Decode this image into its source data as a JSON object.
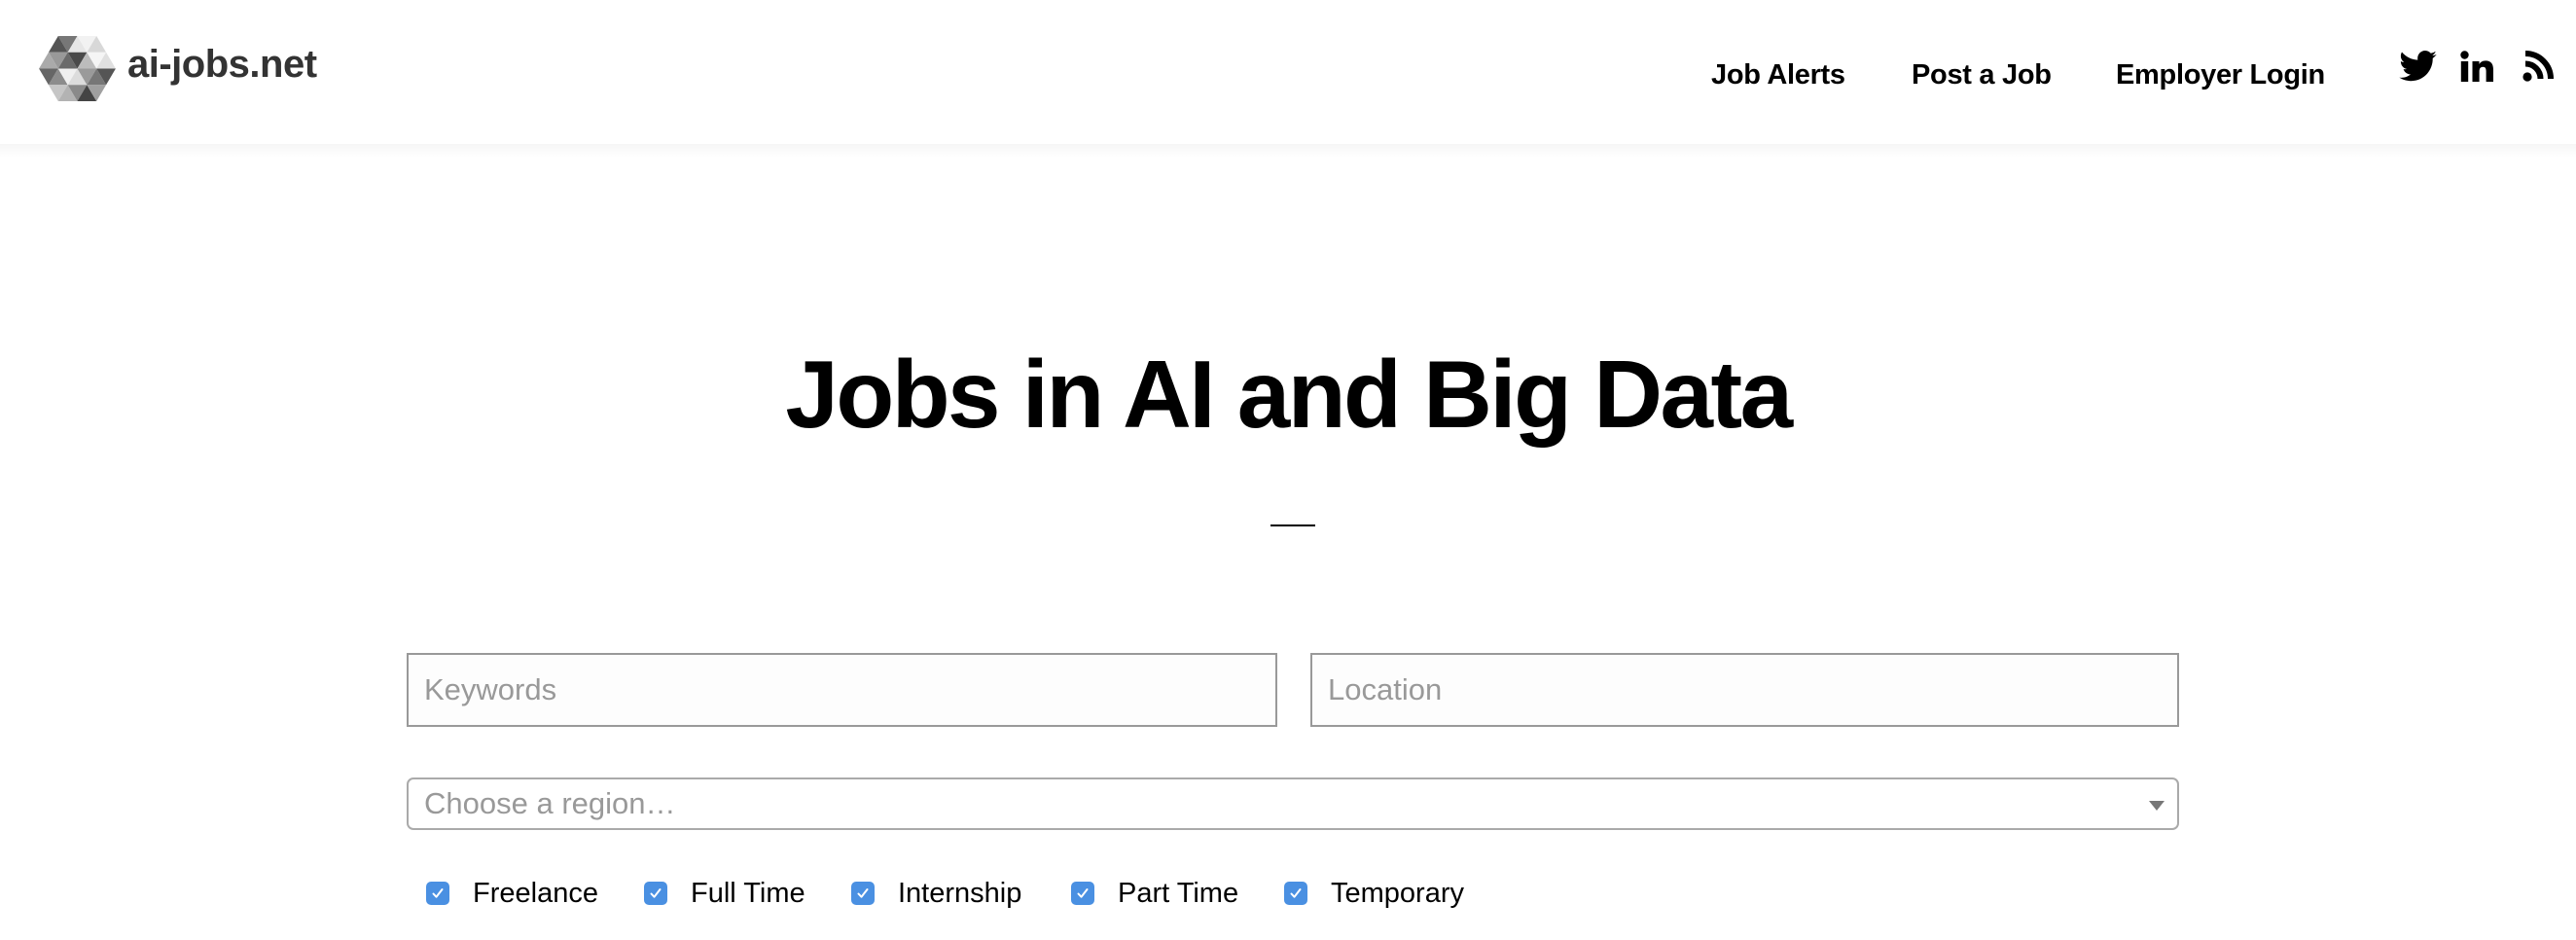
{
  "header": {
    "logo_text": "ai-jobs.net",
    "nav": [
      {
        "label": "Job Alerts"
      },
      {
        "label": "Post a Job"
      },
      {
        "label": "Employer Login"
      }
    ],
    "social": [
      {
        "icon": "twitter-icon",
        "label": "Twitter"
      },
      {
        "icon": "linkedin-icon",
        "label": "LinkedIn"
      },
      {
        "icon": "rss-icon",
        "label": "RSS feed"
      }
    ]
  },
  "main": {
    "title": "Jobs in AI and Big Data",
    "search": {
      "keywords_placeholder": "Keywords",
      "keywords_value": "",
      "location_placeholder": "Location",
      "location_value": "",
      "region_placeholder": "Choose a region…",
      "region_value": ""
    },
    "job_types": [
      {
        "label": "Freelance",
        "checked": true
      },
      {
        "label": "Full Time",
        "checked": true
      },
      {
        "label": "Internship",
        "checked": true
      },
      {
        "label": "Part Time",
        "checked": true
      },
      {
        "label": "Temporary",
        "checked": true
      }
    ]
  },
  "colors": {
    "checkbox_accent": "#4a90e2",
    "input_border": "#999999",
    "placeholder": "#999999",
    "logo_text": "#333333"
  }
}
